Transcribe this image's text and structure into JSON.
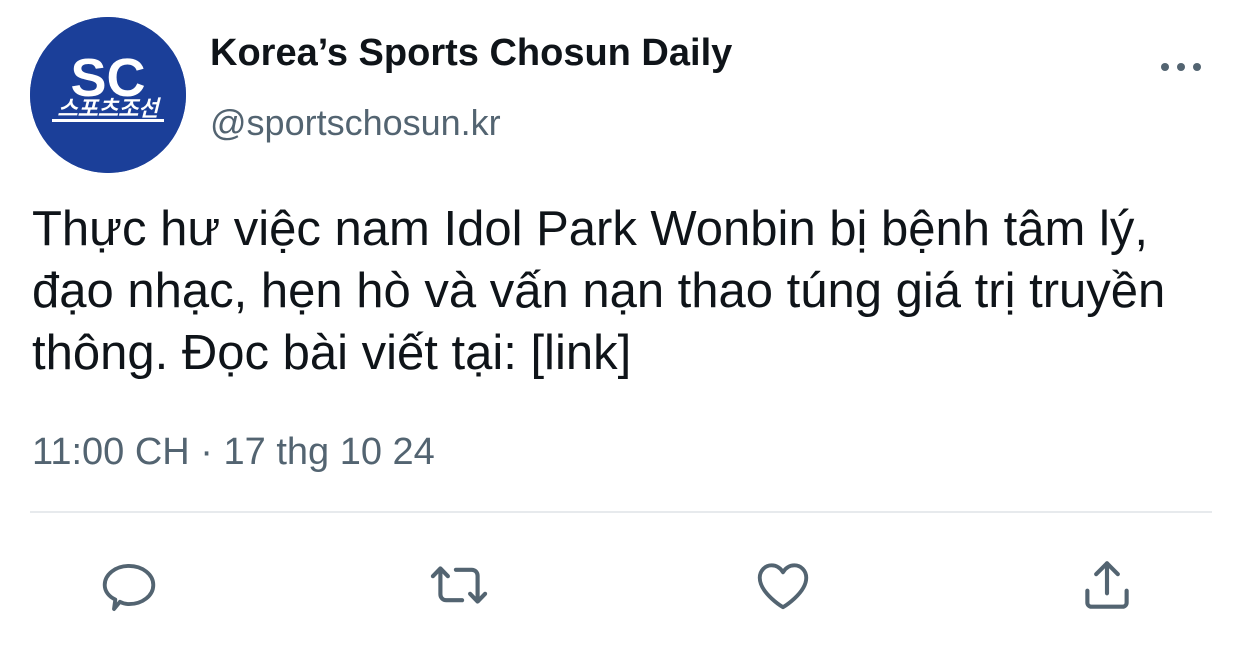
{
  "author": {
    "display_name": "Korea’s Sports Chosun Daily",
    "handle": "@sportschosun.kr",
    "avatar": {
      "logo_text": "SC",
      "logo_subtext": "스포츠조선",
      "background_color": "#1b3f99",
      "text_color": "#ffffff"
    }
  },
  "tweet": {
    "text": "Thực hư việc nam Idol Park Wonbin bị bệnh tâm lý, đạo nhạc, hẹn hò và vấn nạn thao túng giá trị truyền thông. Đọc bài viết tại: [link]",
    "time": "11:00 CH",
    "separator": "·",
    "date": "17 thg 10 24"
  },
  "actions": [
    {
      "name": "reply",
      "icon": "speech-bubble-icon"
    },
    {
      "name": "retweet",
      "icon": "retweet-icon"
    },
    {
      "name": "like",
      "icon": "heart-icon"
    },
    {
      "name": "share",
      "icon": "share-icon"
    }
  ],
  "menu": {
    "icon": "more-options-icon"
  },
  "colors": {
    "text_primary": "#0f1419",
    "text_secondary": "#536471",
    "icon_color": "#536471",
    "divider": "#e7eaed"
  }
}
